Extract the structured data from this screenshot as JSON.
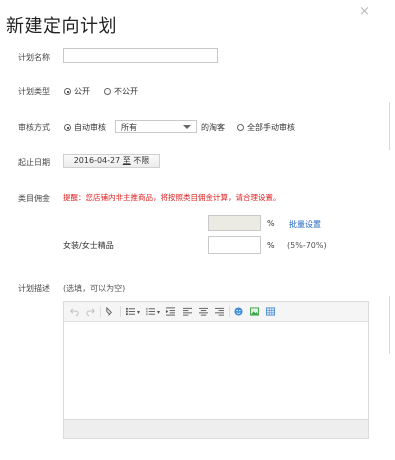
{
  "dialog": {
    "title": "新建定向计划",
    "close_symbol": "×"
  },
  "fields": {
    "plan_name": {
      "label": "计划名称",
      "value": ""
    },
    "plan_type": {
      "label": "计划类型",
      "options": [
        "公开",
        "不公开"
      ],
      "selected": "公开"
    },
    "review": {
      "label": "审核方式",
      "auto_option": "自动审核",
      "select_value": "所有",
      "suffix": "的淘客",
      "manual_option": "全部手动审核",
      "selected": "自动审核"
    },
    "dates": {
      "label": "起止日期",
      "start": "2016-04-27",
      "sep": "至",
      "end": "不限"
    },
    "category_commission": {
      "label": "类目佣金",
      "warning": "提醒：您店铺内非主推商品，将按照类目佣金计算，请合理设置。",
      "batch": {
        "value": "",
        "unit": "%",
        "link": "批量设置"
      },
      "rows": [
        {
          "name": "女装/女士精品",
          "value": "",
          "unit": "%",
          "range": "(5%-70%)"
        }
      ]
    },
    "description": {
      "label": "计划描述",
      "hint": "(选填，可以为空)"
    }
  },
  "editor": {
    "tools": [
      "undo-icon",
      "redo-icon",
      "format-painter-icon",
      "bullet-list-icon",
      "numbered-list-icon",
      "indent-icon",
      "align-left-icon",
      "align-center-icon",
      "align-right-icon",
      "emoji-icon",
      "image-icon",
      "table-icon"
    ],
    "colors": {
      "emoji": "#3a8bd8",
      "image": "#3aa04a",
      "table": "#4a8ad0"
    }
  }
}
